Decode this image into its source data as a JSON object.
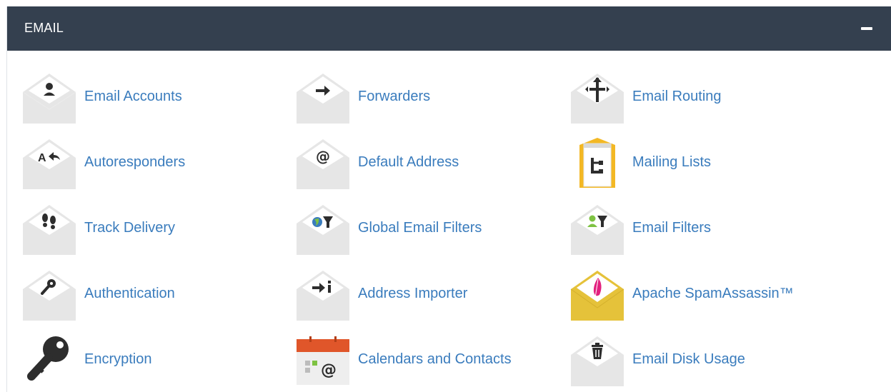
{
  "panel": {
    "title": "EMAIL",
    "collapse_label": "−"
  },
  "items": [
    {
      "label": "Email Accounts",
      "icon": "person-envelope-icon"
    },
    {
      "label": "Forwarders",
      "icon": "arrow-envelope-icon"
    },
    {
      "label": "Email Routing",
      "icon": "signpost-envelope-icon"
    },
    {
      "label": "Autoresponders",
      "icon": "reply-envelope-icon"
    },
    {
      "label": "Default Address",
      "icon": "at-envelope-icon"
    },
    {
      "label": "Mailing Lists",
      "icon": "mailing-lists-icon"
    },
    {
      "label": "Track Delivery",
      "icon": "footprints-envelope-icon"
    },
    {
      "label": "Global Email Filters",
      "icon": "globe-filter-envelope-icon"
    },
    {
      "label": "Email Filters",
      "icon": "person-filter-envelope-icon"
    },
    {
      "label": "Authentication",
      "icon": "key-envelope-icon"
    },
    {
      "label": "Address Importer",
      "icon": "import-envelope-icon"
    },
    {
      "label": "Apache SpamAssassin™",
      "icon": "feather-envelope-icon"
    },
    {
      "label": "Encryption",
      "icon": "key-icon"
    },
    {
      "label": "Calendars and Contacts",
      "icon": "calendar-icon"
    },
    {
      "label": "Email Disk Usage",
      "icon": "trash-envelope-icon"
    }
  ],
  "colors": {
    "header_bg": "#34404f",
    "link": "#3a7cbd",
    "envelope": "#e6e6e6",
    "spam_envelope": "#e5c23a",
    "mailing_yellow": "#f3b824",
    "calendar_red": "#e0562a",
    "feather_pink": "#e2217f"
  }
}
